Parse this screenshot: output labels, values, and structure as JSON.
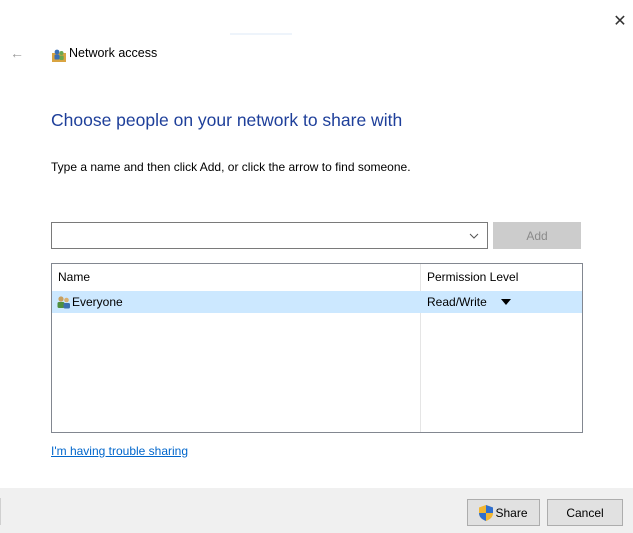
{
  "window": {
    "title": "Network access",
    "close_glyph": "✕",
    "back_glyph": "←"
  },
  "main": {
    "heading": "Choose people on your network to share with",
    "instruction": "Type a name and then click Add, or click the arrow to find someone.",
    "name_input": {
      "value": "",
      "placeholder": ""
    },
    "add_label": "Add"
  },
  "table": {
    "columns": [
      "Name",
      "Permission Level"
    ],
    "rows": [
      {
        "name": "Everyone",
        "permission": "Read/Write"
      }
    ]
  },
  "help_link": "I'm having trouble sharing",
  "footer": {
    "share_label": "Share",
    "cancel_label": "Cancel"
  },
  "colors": {
    "heading": "#1e3f9a",
    "link": "#0066cc",
    "selected_row": "#cce8ff",
    "footer_bg": "#f0f0f0",
    "disabled_button": "#cccccc"
  },
  "icons": {
    "title": "network-people-icon",
    "row": "users-group-icon",
    "share": "uac-shield-icon"
  }
}
